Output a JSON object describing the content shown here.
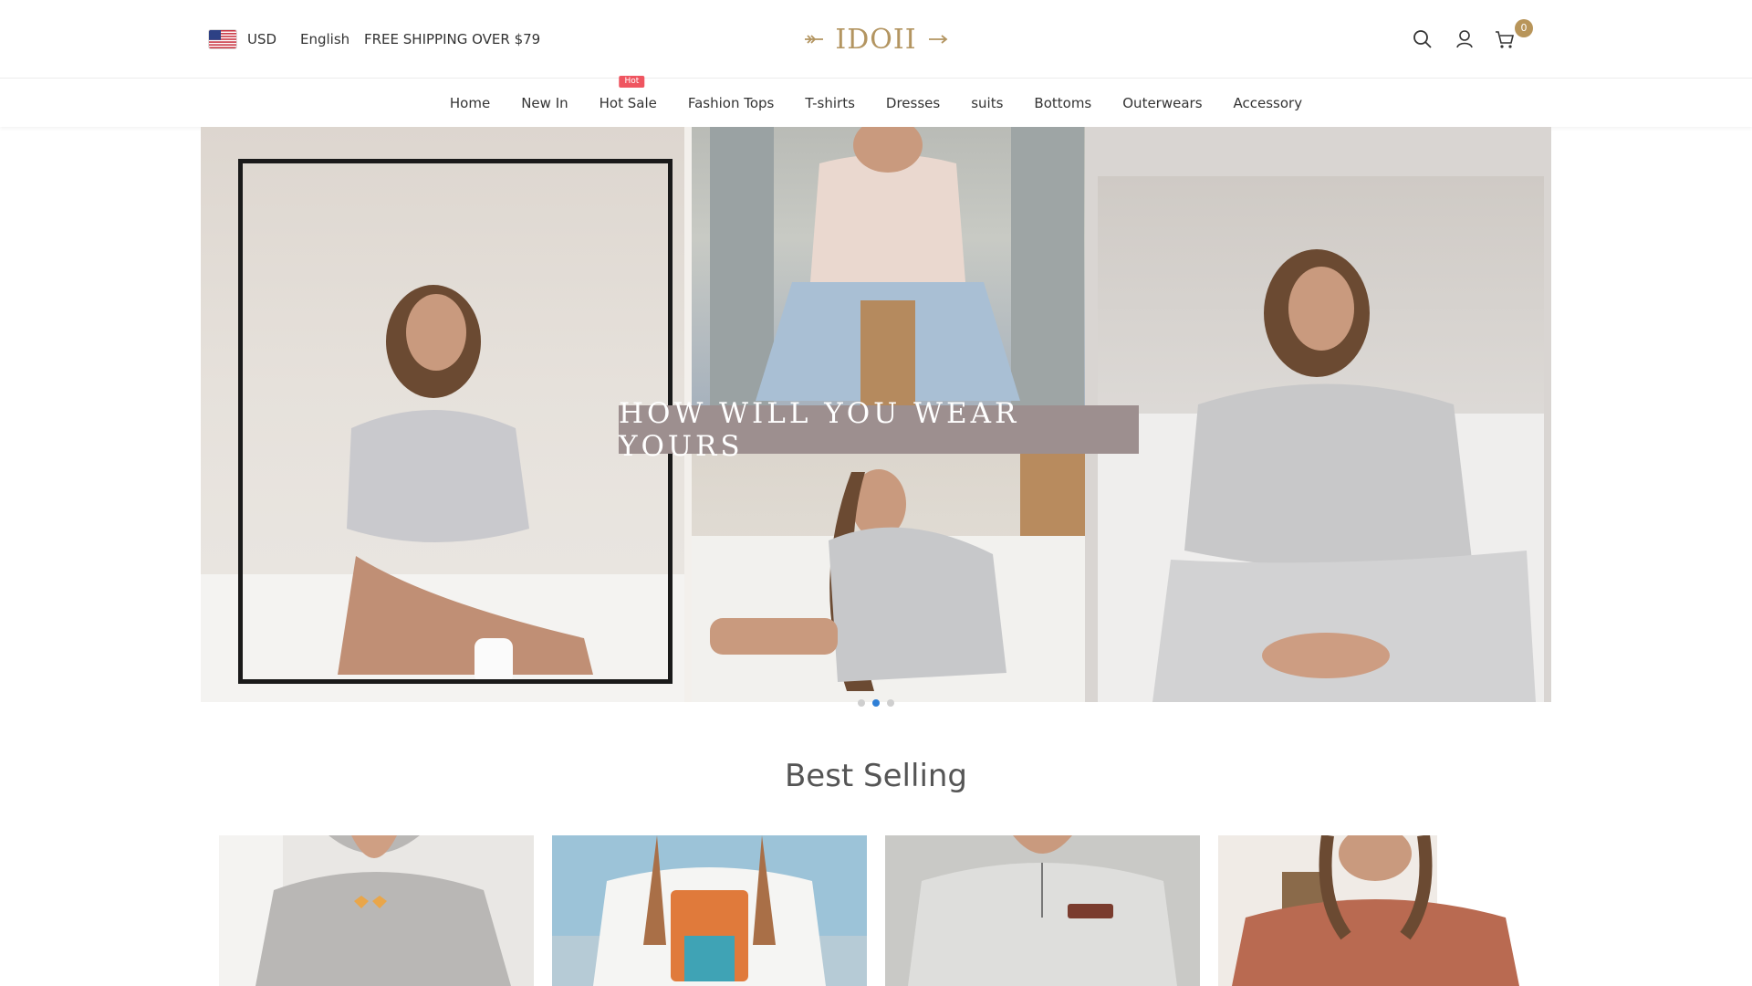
{
  "header": {
    "currency": "USD",
    "language": "English",
    "shipping_notice": "FREE SHIPPING OVER $79",
    "logo_text": "IDOII",
    "cart_count": "0",
    "icons": [
      "us-flag-icon",
      "search-icon",
      "account-icon",
      "cart-icon"
    ]
  },
  "nav": {
    "items": [
      {
        "label": "Home"
      },
      {
        "label": "New In"
      },
      {
        "label": "Hot Sale",
        "badge": "Hot"
      },
      {
        "label": "Fashion Tops"
      },
      {
        "label": "T-shirts"
      },
      {
        "label": "Dresses"
      },
      {
        "label": "suits"
      },
      {
        "label": "Bottoms"
      },
      {
        "label": "Outerwears"
      },
      {
        "label": "Accessory"
      }
    ]
  },
  "hero": {
    "banner_text": "HOW WILL YOU WEAR YOURS",
    "slides": 3,
    "active_slide": 2
  },
  "best_selling": {
    "title": "Best Selling",
    "products": [
      {
        "color": "#b9b7b5"
      },
      {
        "color": "#e8eef2"
      },
      {
        "color": "#d4d4d2"
      },
      {
        "color": "#b96a51"
      }
    ]
  },
  "colors": {
    "brand_gold": "#b39561",
    "badge_red": "#ef5560",
    "dot_active": "#2f7fd6",
    "banner_bg": "#9d8f8f"
  }
}
